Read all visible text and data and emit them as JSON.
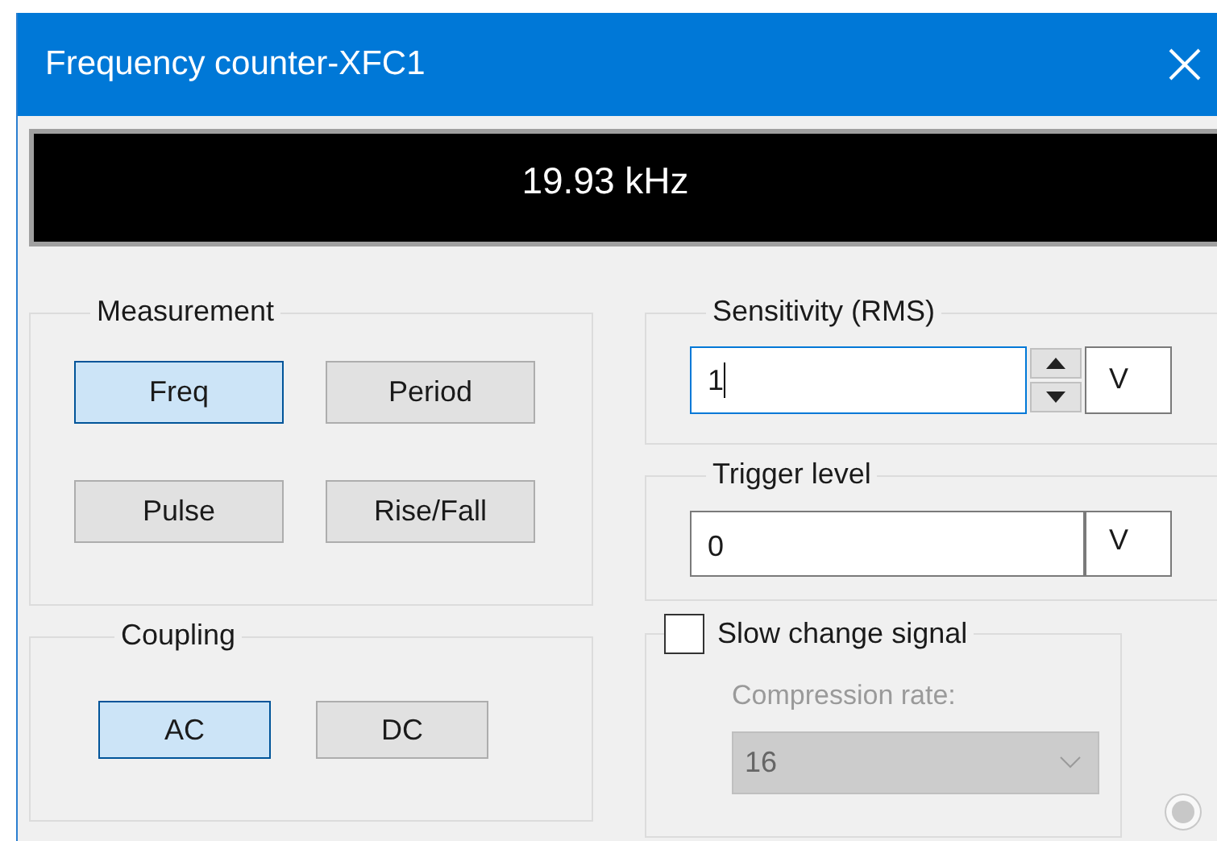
{
  "window": {
    "title": "Frequency counter-XFC1"
  },
  "display": {
    "reading": "19.93 kHz"
  },
  "measurement": {
    "label": "Measurement",
    "buttons": [
      {
        "label": "Freq",
        "selected": true
      },
      {
        "label": "Period",
        "selected": false
      },
      {
        "label": "Pulse",
        "selected": false
      },
      {
        "label": "Rise/Fall",
        "selected": false
      }
    ]
  },
  "coupling": {
    "label": "Coupling",
    "buttons": [
      {
        "label": "AC",
        "selected": true
      },
      {
        "label": "DC",
        "selected": false
      }
    ]
  },
  "sensitivity": {
    "label": "Sensitivity (RMS)",
    "value": "1",
    "unit": "V",
    "focused": true
  },
  "trigger_level": {
    "label": "Trigger level",
    "value": "0",
    "unit": "V"
  },
  "slow_change": {
    "label": "Slow change signal",
    "checked": false,
    "compression_label": "Compression rate:",
    "compression_value": "16",
    "disabled": true
  }
}
